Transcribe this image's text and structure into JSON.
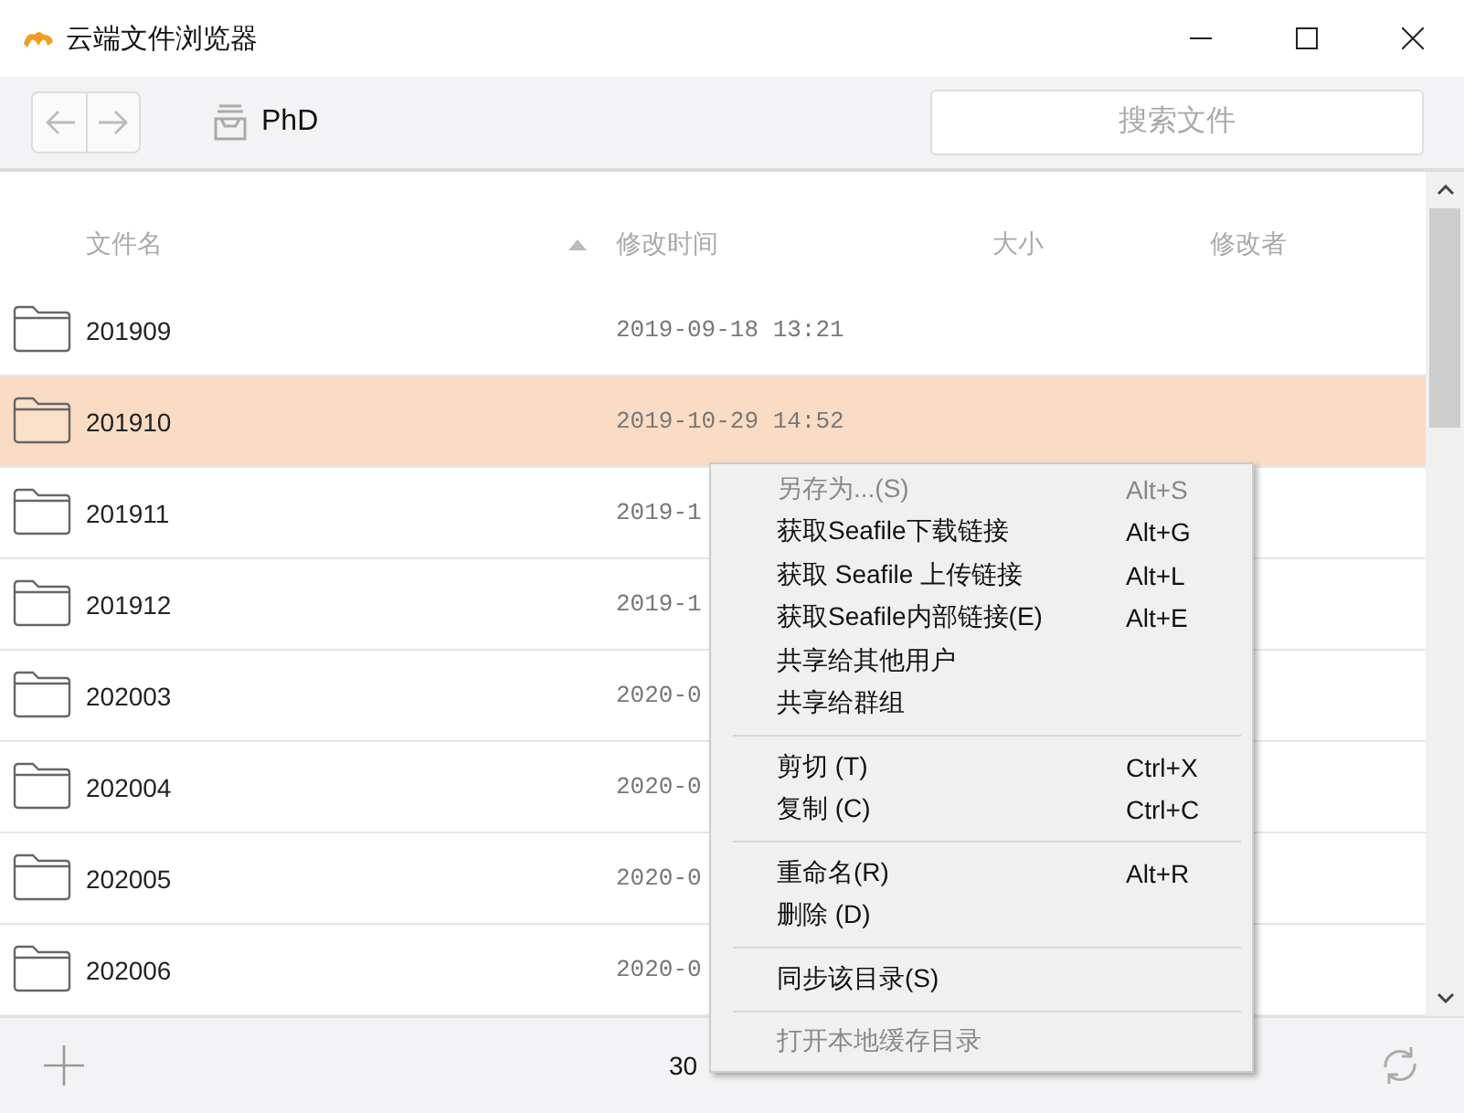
{
  "window": {
    "title": "云端文件浏览器"
  },
  "toolbar": {
    "path": "PhD",
    "search": {
      "placeholder": "搜索文件"
    }
  },
  "table": {
    "columns": [
      {
        "label": "文件名",
        "sorted": true
      },
      {
        "label": "修改时间",
        "sorted": false
      },
      {
        "label": "大小",
        "sorted": false
      },
      {
        "label": "修改者",
        "sorted": false
      }
    ],
    "rows": [
      {
        "name": "201909",
        "modified": "2019-09-18 13:21",
        "selected": false
      },
      {
        "name": "201910",
        "modified": "2019-10-29 14:52",
        "selected": true
      },
      {
        "name": "201911",
        "modified": "2019-1",
        "selected": false
      },
      {
        "name": "201912",
        "modified": "2019-1",
        "selected": false
      },
      {
        "name": "202003",
        "modified": "2020-0",
        "selected": false
      },
      {
        "name": "202004",
        "modified": "2020-0",
        "selected": false
      },
      {
        "name": "202005",
        "modified": "2020-0",
        "selected": false
      },
      {
        "name": "202006",
        "modified": "2020-0",
        "selected": false
      }
    ]
  },
  "status_bar": {
    "text": "30"
  },
  "context_menu": {
    "items": [
      {
        "kind": "item",
        "label": "另存为...(S)",
        "shortcut": "Alt+S",
        "disabled": true
      },
      {
        "kind": "item",
        "label": "获取Seafile下载链接",
        "shortcut": "Alt+G",
        "disabled": false
      },
      {
        "kind": "item",
        "label": "获取 Seafile 上传链接",
        "shortcut": "Alt+L",
        "disabled": false
      },
      {
        "kind": "item",
        "label": "获取Seafile内部链接(E)",
        "shortcut": "Alt+E",
        "disabled": false
      },
      {
        "kind": "item",
        "label": "共享给其他用户",
        "disabled": false
      },
      {
        "kind": "item",
        "label": "共享给群组",
        "disabled": false
      },
      {
        "kind": "separator"
      },
      {
        "kind": "item",
        "label": "剪切 (T)",
        "shortcut": "Ctrl+X",
        "disabled": false
      },
      {
        "kind": "item",
        "label": "复制 (C)",
        "shortcut": "Ctrl+C",
        "disabled": false
      },
      {
        "kind": "separator"
      },
      {
        "kind": "item",
        "label": "重命名(R)",
        "shortcut": "Alt+R",
        "disabled": false
      },
      {
        "kind": "item",
        "label": "删除 (D)",
        "disabled": false
      },
      {
        "kind": "separator"
      },
      {
        "kind": "item",
        "label": "同步该目录(S)",
        "disabled": false
      },
      {
        "kind": "separator"
      },
      {
        "kind": "item",
        "label": "打开本地缓存目录",
        "disabled": true
      }
    ]
  }
}
